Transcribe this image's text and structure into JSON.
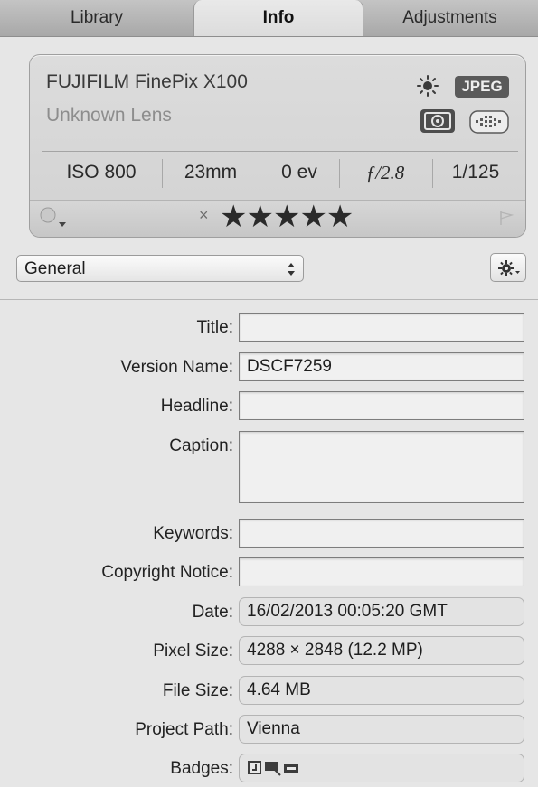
{
  "tabs": [
    {
      "label": "Library",
      "active": false
    },
    {
      "label": "Info",
      "active": true
    },
    {
      "label": "Adjustments",
      "active": false
    }
  ],
  "camera": {
    "model": "FUJIFILM FinePix X100",
    "lens": "Unknown Lens",
    "format_badge": "JPEG",
    "icons": [
      "sun-icon",
      "metering-mode-icon",
      "af-points-icon"
    ],
    "exif": {
      "iso": "ISO 800",
      "focal_length": "23mm",
      "exposure_bias": "0 ev",
      "aperture": "ƒ/2.8",
      "shutter": "1/125"
    },
    "rating": {
      "reject_symbol": "×",
      "stars": "★★★★★",
      "value": 5
    }
  },
  "metadata_view": {
    "preset_selected": "General"
  },
  "fields": [
    {
      "label": "Title:",
      "value": "",
      "kind": "editable"
    },
    {
      "label": "Version Name:",
      "value": "DSCF7259",
      "kind": "editable"
    },
    {
      "label": "Headline:",
      "value": "",
      "kind": "editable"
    },
    {
      "label": "Caption:",
      "value": "",
      "kind": "editable"
    },
    {
      "label": "Keywords:",
      "value": "",
      "kind": "editable"
    },
    {
      "label": "Copyright Notice:",
      "value": "",
      "kind": "editable"
    },
    {
      "label": "Date:",
      "value": "16/02/2013 00:05:20 GMT",
      "kind": "readonly"
    },
    {
      "label": "Pixel Size:",
      "value": "4288 × 2848 (12.2 MP)",
      "kind": "readonly"
    },
    {
      "label": "File Size:",
      "value": "4.64 MB",
      "kind": "readonly"
    },
    {
      "label": "Project Path:",
      "value": "Vienna",
      "kind": "readonly"
    },
    {
      "label": "Badges:",
      "value": "",
      "kind": "readonly"
    }
  ],
  "colors": {
    "tab_bar": "#b4b4b4",
    "panel_bg": "#e6e6e6",
    "badge_dark": "#5a5a5a"
  }
}
